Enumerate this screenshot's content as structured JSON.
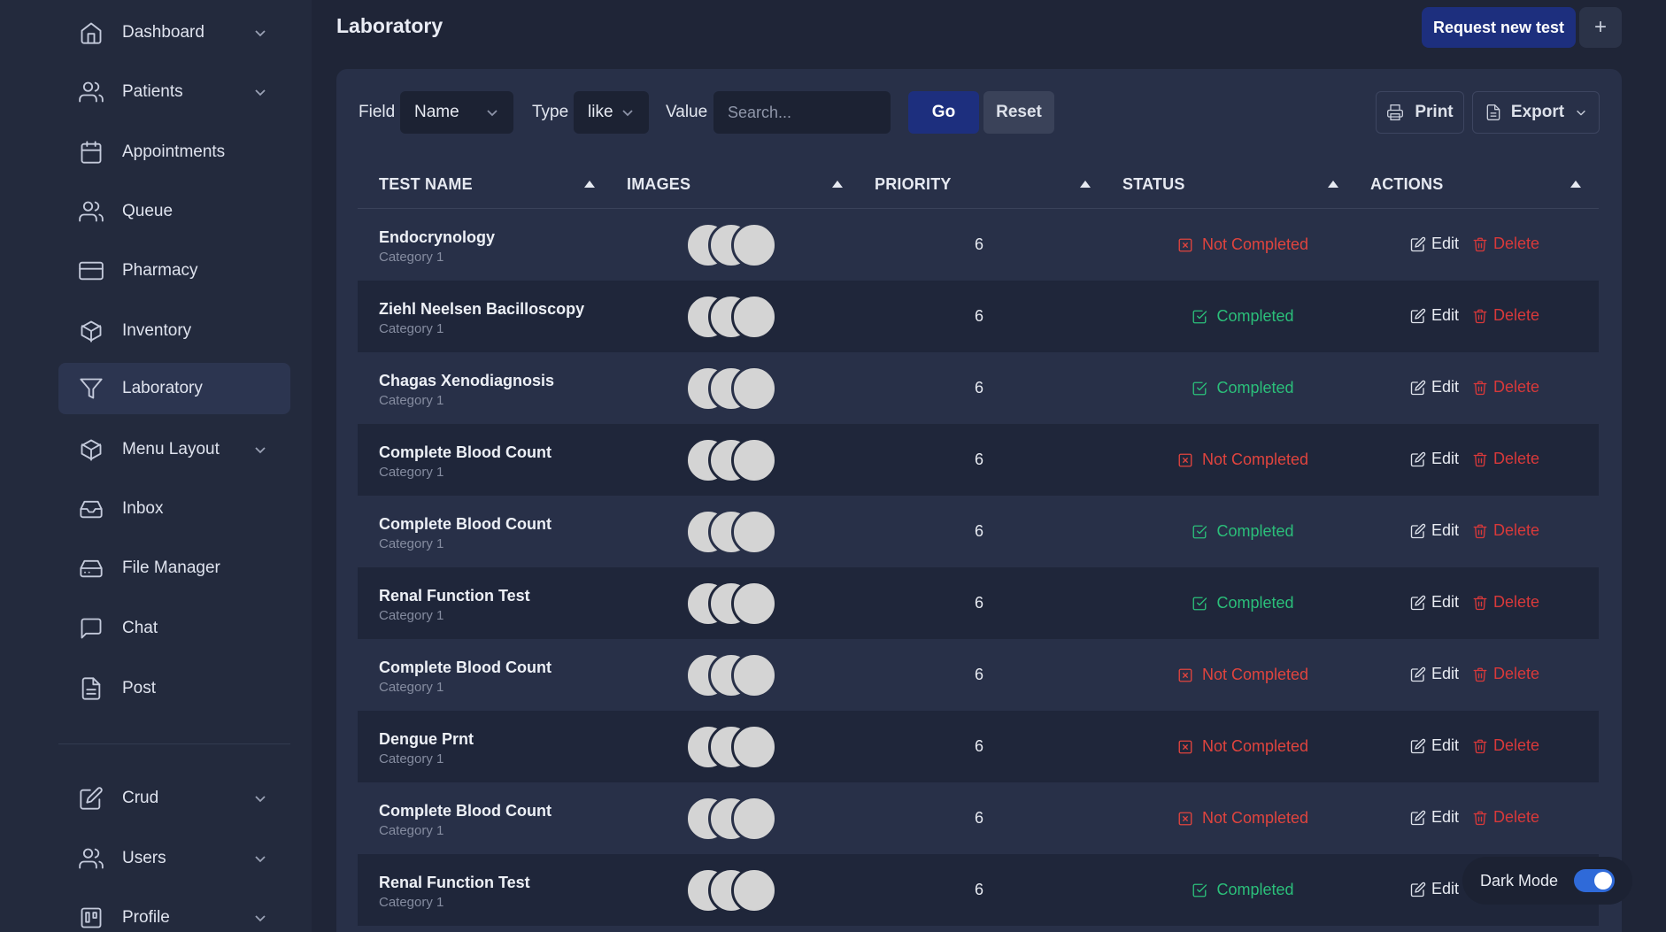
{
  "sidebar": {
    "items": [
      {
        "label": "Dashboard",
        "icon": "home-icon",
        "chevron": true
      },
      {
        "label": "Patients",
        "icon": "users-icon",
        "chevron": true
      },
      {
        "label": "Appointments",
        "icon": "calendar-icon",
        "chevron": false
      },
      {
        "label": "Queue",
        "icon": "users-icon",
        "chevron": false
      },
      {
        "label": "Pharmacy",
        "icon": "credit-card-icon",
        "chevron": false
      },
      {
        "label": "Inventory",
        "icon": "box-icon",
        "chevron": false
      },
      {
        "label": "Laboratory",
        "icon": "filter-icon",
        "chevron": false,
        "active": true
      },
      {
        "label": "Menu Layout",
        "icon": "box-icon",
        "chevron": true
      },
      {
        "label": "Inbox",
        "icon": "inbox-icon",
        "chevron": false
      },
      {
        "label": "File Manager",
        "icon": "hard-drive-icon",
        "chevron": false
      },
      {
        "label": "Chat",
        "icon": "message-square-icon",
        "chevron": false
      },
      {
        "label": "Post",
        "icon": "file-text-icon",
        "chevron": false
      },
      {
        "label": "Crud",
        "icon": "edit-icon",
        "chevron": true
      },
      {
        "label": "Users",
        "icon": "users-icon",
        "chevron": true
      },
      {
        "label": "Profile",
        "icon": "trello-icon",
        "chevron": true
      }
    ]
  },
  "header": {
    "title": "Laboratory",
    "request_label": "Request new test",
    "plus_label": "+"
  },
  "filters": {
    "field_label": "Field",
    "field_value": "Name",
    "type_label": "Type",
    "type_value": "like",
    "value_label": "Value",
    "search_placeholder": "Search...",
    "go_label": "Go",
    "reset_label": "Reset",
    "print_label": "Print",
    "export_label": "Export"
  },
  "table": {
    "columns": [
      "TEST NAME",
      "IMAGES",
      "PRIORITY",
      "STATUS",
      "ACTIONS"
    ],
    "edit_label": "Edit",
    "delete_label": "Delete",
    "rows": [
      {
        "name": "Endocrynology",
        "category": "Category 1",
        "priority": "6",
        "status": "Not Completed",
        "done": false
      },
      {
        "name": "Ziehl Neelsen Bacilloscopy",
        "category": "Category 1",
        "priority": "6",
        "status": "Completed",
        "done": true
      },
      {
        "name": "Chagas Xenodiagnosis",
        "category": "Category 1",
        "priority": "6",
        "status": "Completed",
        "done": true
      },
      {
        "name": "Complete Blood Count",
        "category": "Category 1",
        "priority": "6",
        "status": "Not Completed",
        "done": false
      },
      {
        "name": "Complete Blood Count",
        "category": "Category 1",
        "priority": "6",
        "status": "Completed",
        "done": true
      },
      {
        "name": "Renal Function Test",
        "category": "Category 1",
        "priority": "6",
        "status": "Completed",
        "done": true
      },
      {
        "name": "Complete Blood Count",
        "category": "Category 1",
        "priority": "6",
        "status": "Not Completed",
        "done": false
      },
      {
        "name": "Dengue Prnt",
        "category": "Category 1",
        "priority": "6",
        "status": "Not Completed",
        "done": false
      },
      {
        "name": "Complete Blood Count",
        "category": "Category 1",
        "priority": "6",
        "status": "Not Completed",
        "done": false
      },
      {
        "name": "Renal Function Test",
        "category": "Category 1",
        "priority": "6",
        "status": "Completed",
        "done": true
      }
    ]
  },
  "dark_mode": {
    "label": "Dark Mode",
    "enabled": true
  },
  "colors": {
    "background": "#1f2537",
    "panel": "#283048",
    "primary": "#1d2f7e",
    "success": "#2bbf7a",
    "danger": "#e0443e"
  }
}
